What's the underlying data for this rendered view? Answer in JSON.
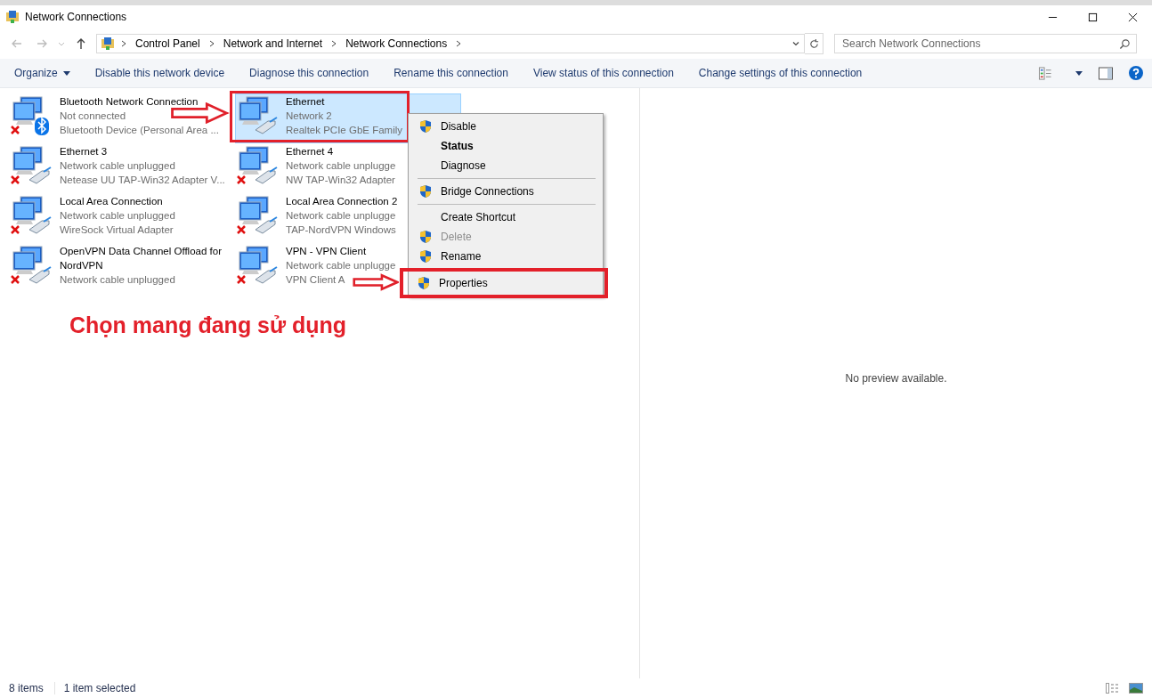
{
  "window": {
    "title": "Network Connections"
  },
  "address_bar": {
    "crumbs": [
      "Control Panel",
      "Network and Internet",
      "Network Connections"
    ]
  },
  "search": {
    "placeholder": "Search Network Connections"
  },
  "toolbar": [
    {
      "label": "Organize",
      "dropdown": true
    },
    {
      "label": "Disable this network device",
      "dropdown": false
    },
    {
      "label": "Diagnose this connection",
      "dropdown": false
    },
    {
      "label": "Rename this connection",
      "dropdown": false
    },
    {
      "label": "View status of this connection",
      "dropdown": false
    },
    {
      "label": "Change settings of this connection",
      "dropdown": false
    }
  ],
  "connections": [
    {
      "name": "Bluetooth Network Connection",
      "status": "Not connected",
      "device": "Bluetooth Device (Personal Area ...",
      "kind": "bluetooth",
      "connected": false,
      "selected": false
    },
    {
      "name": "Ethernet",
      "status": "Network 2",
      "device": "Realtek PCIe GbE Family",
      "kind": "wired",
      "connected": true,
      "selected": true
    },
    {
      "name": "Ethernet 3",
      "status": "Network cable unplugged",
      "device": "Netease UU TAP-Win32 Adapter V...",
      "kind": "wired",
      "connected": false,
      "selected": false
    },
    {
      "name": "Ethernet 4",
      "status": "Network cable unplugge",
      "device": "NW TAP-Win32 Adapter",
      "kind": "wired",
      "connected": false,
      "selected": false
    },
    {
      "name": "Local Area Connection",
      "status": "Network cable unplugged",
      "device": "WireSock Virtual Adapter",
      "kind": "wired",
      "connected": false,
      "selected": false
    },
    {
      "name": "Local Area Connection 2",
      "status": "Network cable unplugge",
      "device": "TAP-NordVPN Windows",
      "kind": "wired",
      "connected": false,
      "selected": false
    },
    {
      "name": "OpenVPN Data Channel Offload for NordVPN",
      "status": "Network cable unplugged",
      "kind": "wired",
      "connected": false,
      "selected": false
    },
    {
      "name": "VPN - VPN Client",
      "status": "Network cable unplugge",
      "device": "VPN Client A",
      "kind": "wired",
      "connected": false,
      "selected": false
    }
  ],
  "context_menu": [
    {
      "kind": "item",
      "label": "Disable",
      "shield": true,
      "default": false,
      "disabled": false,
      "marked": false
    },
    {
      "kind": "item",
      "label": "Status",
      "shield": false,
      "default": true,
      "disabled": false,
      "marked": false
    },
    {
      "kind": "item",
      "label": "Diagnose",
      "shield": false,
      "default": false,
      "disabled": false,
      "marked": false
    },
    {
      "kind": "separator"
    },
    {
      "kind": "item",
      "label": "Bridge Connections",
      "shield": true,
      "default": false,
      "disabled": false,
      "marked": false
    },
    {
      "kind": "separator"
    },
    {
      "kind": "item",
      "label": "Create Shortcut",
      "shield": false,
      "default": false,
      "disabled": false,
      "marked": false
    },
    {
      "kind": "item",
      "label": "Delete",
      "shield": true,
      "default": false,
      "disabled": true,
      "marked": false
    },
    {
      "kind": "item",
      "label": "Rename",
      "shield": true,
      "default": false,
      "disabled": false,
      "marked": false
    },
    {
      "kind": "item",
      "label": "Properties",
      "shield": true,
      "default": false,
      "disabled": false,
      "marked": true
    }
  ],
  "annotation": {
    "text": "Chọn mang đang sử dụng"
  },
  "preview": {
    "message": "No preview available."
  },
  "status_bar": {
    "count": "8 items",
    "selection": "1 item selected"
  }
}
